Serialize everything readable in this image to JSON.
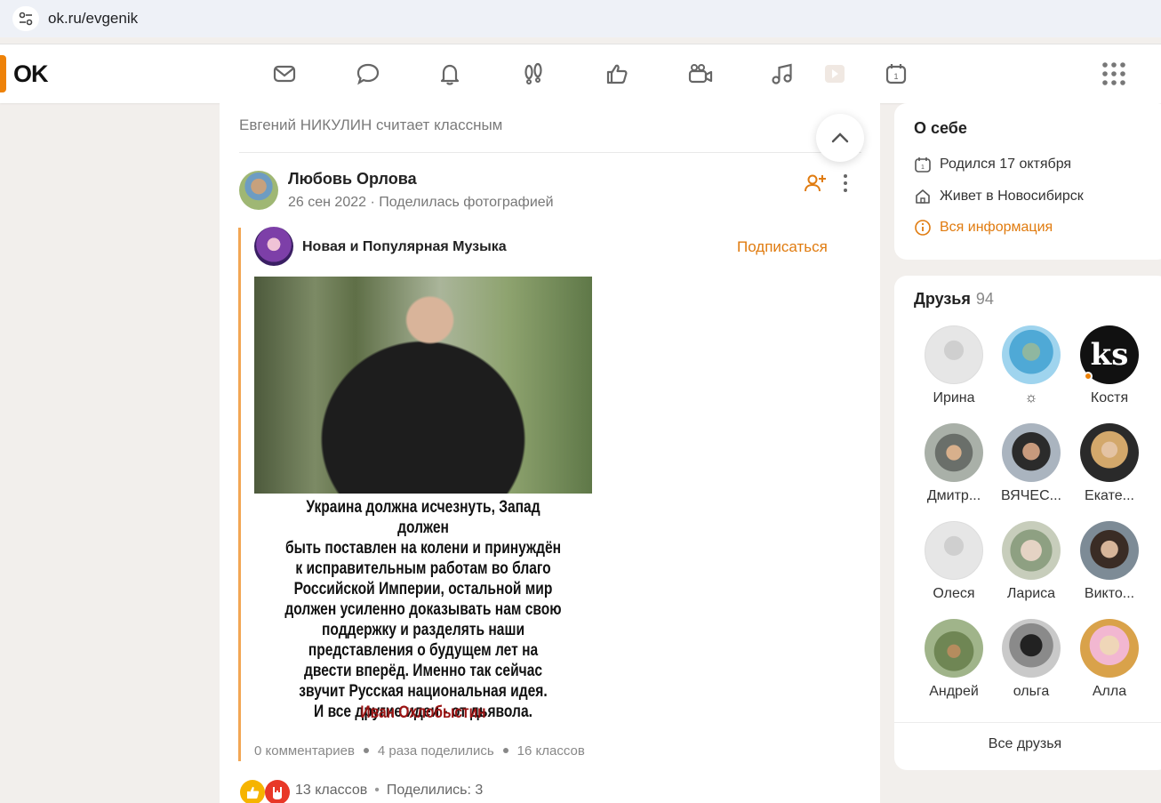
{
  "browser": {
    "url": "ok.ru/evgenik"
  },
  "logo": {
    "text": "OK"
  },
  "nav": {
    "icons": [
      "messages-icon",
      "discussions-icon",
      "notifications-icon",
      "guests-icon",
      "likes-icon",
      "video-call-icon",
      "music-icon",
      "video-icon",
      "calendar-icon"
    ]
  },
  "feed": {
    "header": "Евгений НИКУЛИН считает классным",
    "post": {
      "author": "Любовь Орлова",
      "meta": "26 сен 2022 · Поделилась фотографией",
      "group": {
        "name": "Новая и Популярная Музыка",
        "subscribe": "Подписаться"
      },
      "quote_lines": [
        "Украина должна исчезнуть, Запад должен",
        "быть поставлен на колени и принуждён",
        "к исправительным работам во благо",
        "Российской Империи, остальной мир",
        "должен усиленно доказывать нам свою",
        "поддержку и разделять наши",
        "представления о будущем лет на",
        "двести вперёд. Именно так сейчас",
        "звучит Русская национальная идея.",
        "И все другие идеи - от дьявола."
      ],
      "quote_author": "Иван Охлобыстин",
      "stats": {
        "comments": "0 комментариев",
        "shares": "4 раза поделились",
        "classes": "16 классов"
      },
      "footer": {
        "classes": "13 классов",
        "shared": "Поделились: 3"
      }
    }
  },
  "about": {
    "title": "О себе",
    "born": "Родился 17 октября",
    "lives": "Живет в Новосибирск",
    "all_info": "Вся информация"
  },
  "friends": {
    "title": "Друзья",
    "count": "94",
    "list": [
      {
        "name": "Ирина"
      },
      {
        "name": "☼"
      },
      {
        "name": "Костя"
      },
      {
        "name": "Дмитр..."
      },
      {
        "name": "ВЯЧЕС..."
      },
      {
        "name": "Екате..."
      },
      {
        "name": "Олеся"
      },
      {
        "name": "Лариса"
      },
      {
        "name": "Викто..."
      },
      {
        "name": "Андрей"
      },
      {
        "name": "ольга"
      },
      {
        "name": "Алла"
      }
    ],
    "kostya_avatar_text": "ks",
    "all_friends": "Все друзья"
  },
  "colors": {
    "accent": "#ee8208",
    "link": "#e07b0f",
    "page_bg": "#f2efec"
  }
}
